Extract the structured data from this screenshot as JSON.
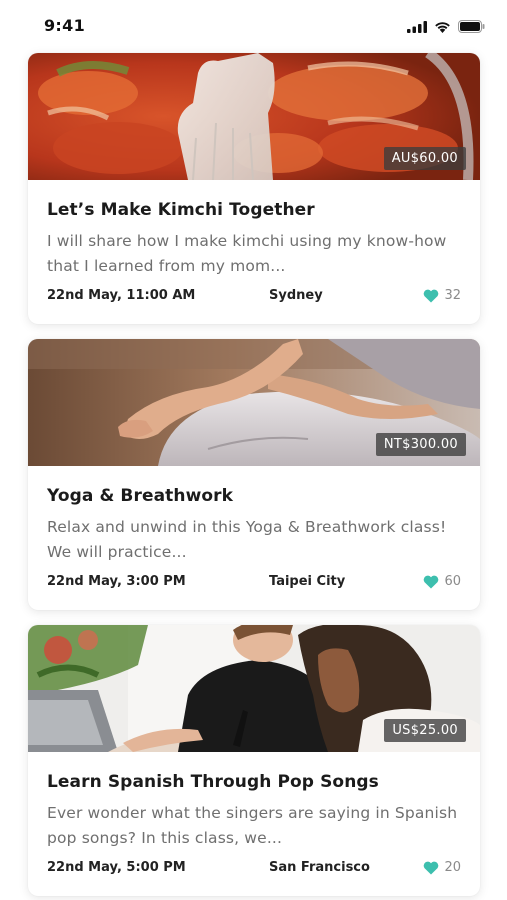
{
  "status": {
    "time": "9:41",
    "icons": [
      "cellular-signal-icon",
      "wifi-icon",
      "battery-icon"
    ]
  },
  "colors": {
    "heart": "#3dbfae",
    "price_bg": "#3c3c3c"
  },
  "cards": [
    {
      "image": "kimchi-photo",
      "price": "AU$60.00",
      "title": "Let’s Make Kimchi Together",
      "description": "I will share how I make kimchi using my know-how that I learned from my mom...",
      "date": "22nd May, 11:00 AM",
      "city": "Sydney",
      "likes": "32"
    },
    {
      "image": "yoga-photo",
      "price": "NT$300.00",
      "title": "Yoga & Breathwork",
      "description": "Relax and unwind in this Yoga & Breathwork class! We will practice...",
      "date": "22nd May, 3:00 PM",
      "city": "Taipei City",
      "likes": "60"
    },
    {
      "image": "spanish-class-photo",
      "price": "US$25.00",
      "title": "Learn Spanish Through Pop Songs",
      "description": "Ever wonder what the singers are saying in Spanish pop songs? In this class, we...",
      "date": "22nd May, 5:00 PM",
      "city": "San Francisco",
      "likes": "20"
    }
  ]
}
